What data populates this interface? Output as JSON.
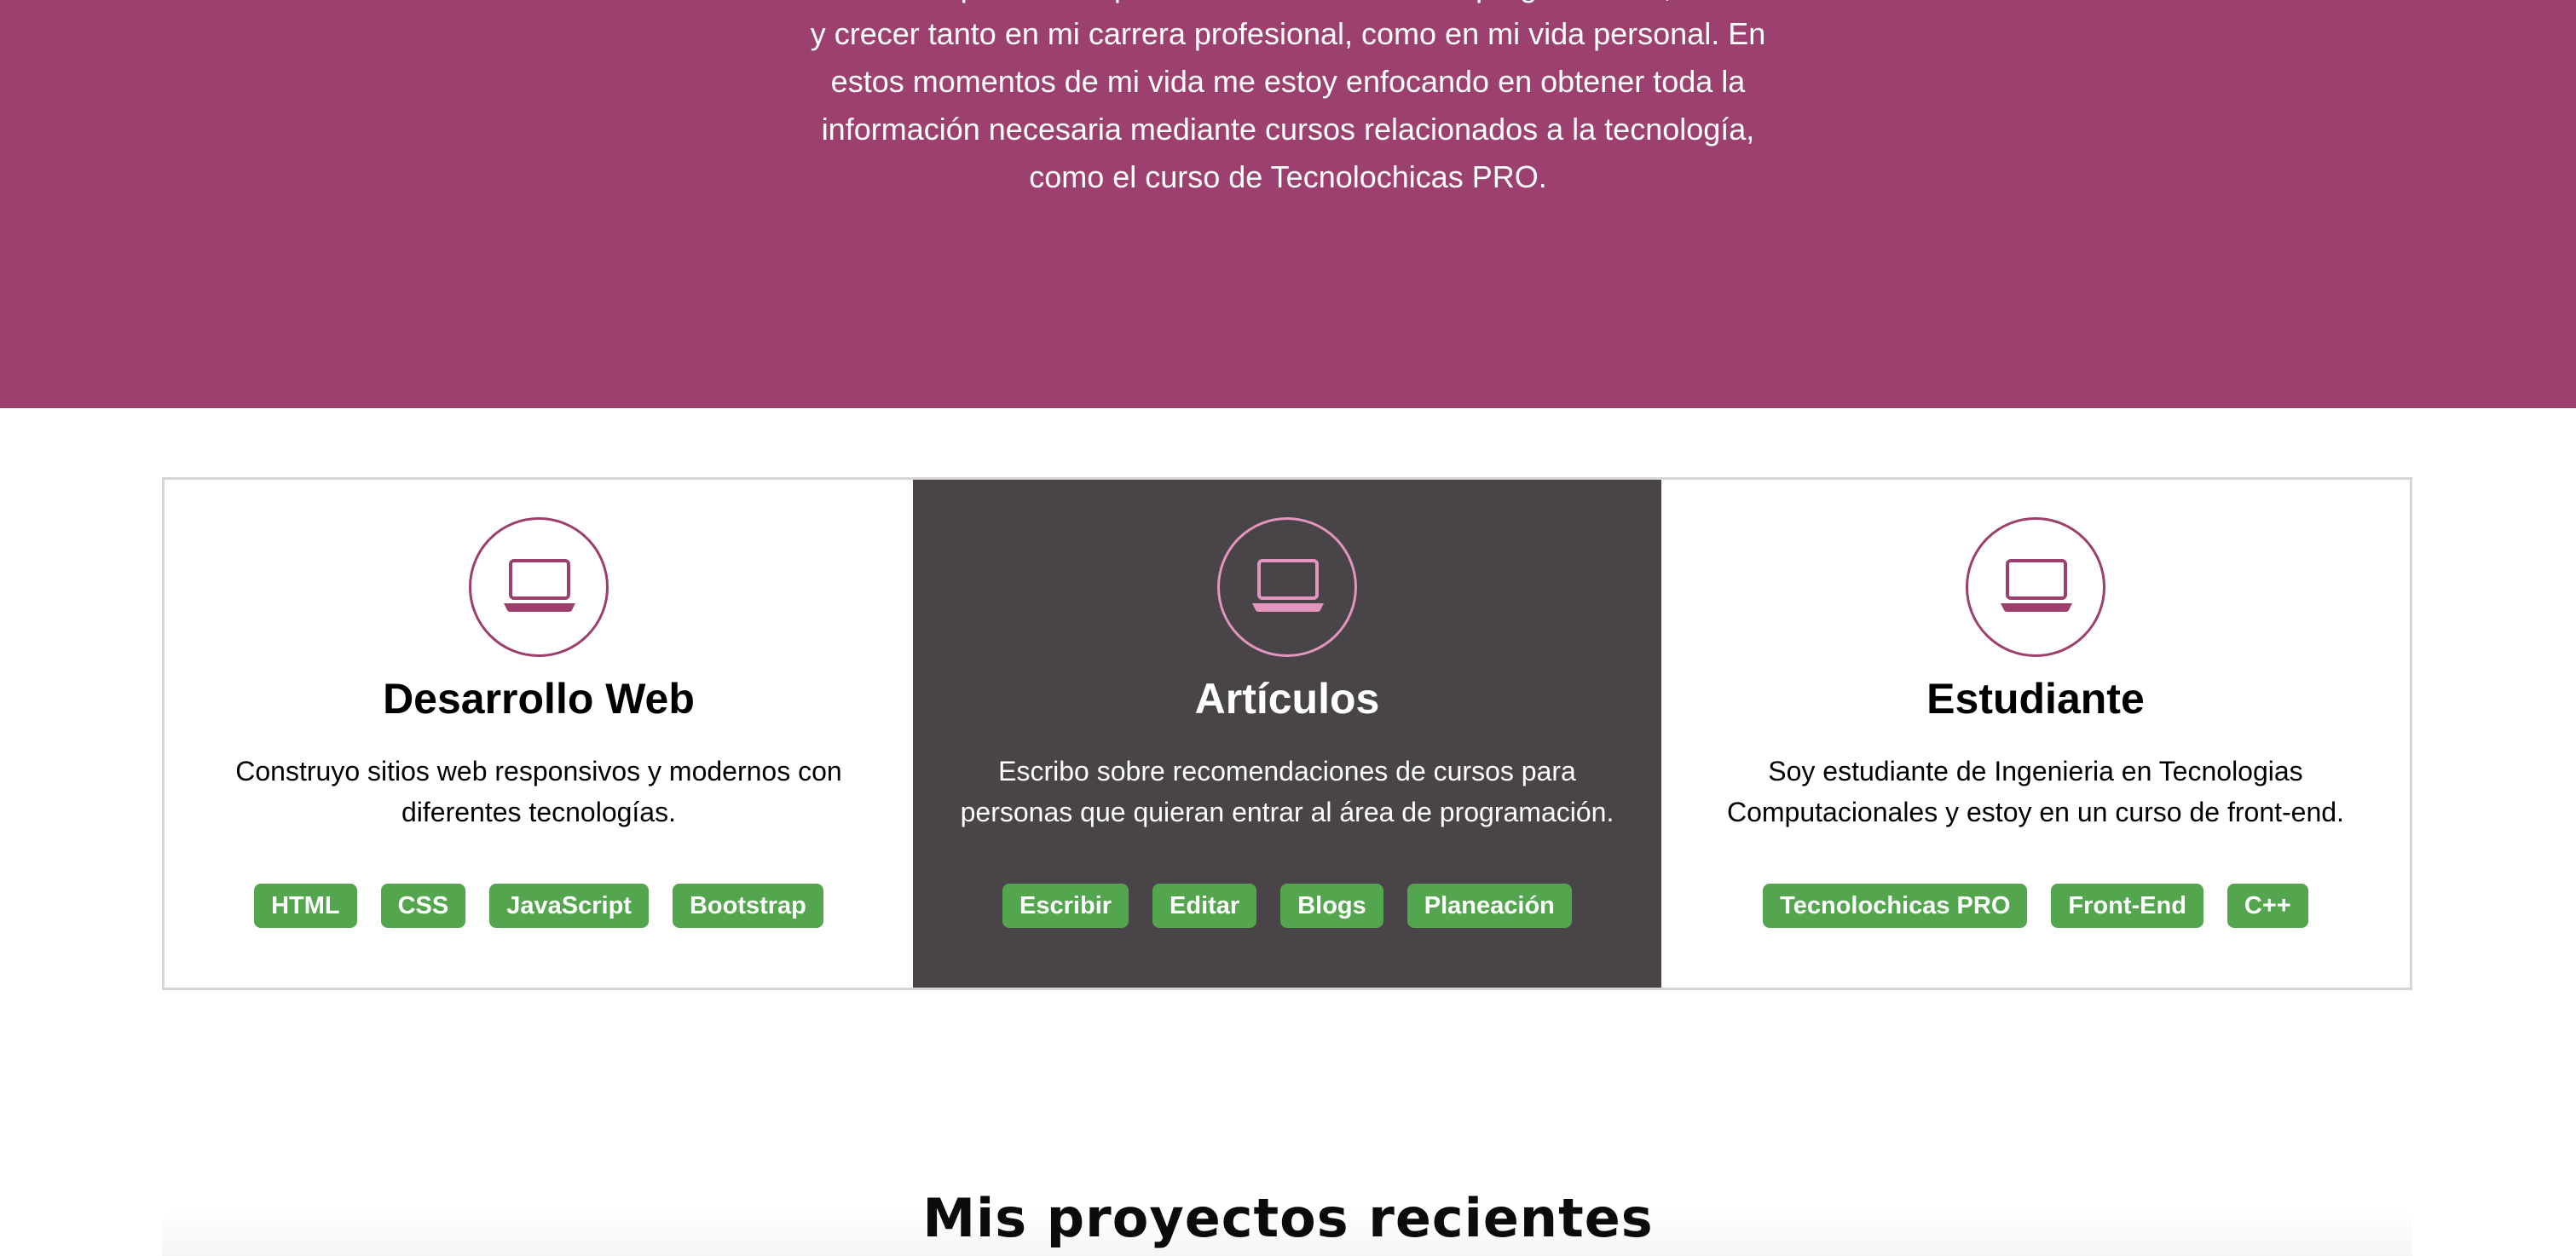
{
  "hero": {
    "lines": [
      "… aprender … para … en el mundo de la programación,",
      "y crecer tanto en mi carrera profesional, como en mi vida personal. En",
      "estos momentos de mi vida me estoy enfocando en obtener toda la",
      "información necesaria mediante cursos relacionados a la tecnología,",
      "como el curso de Tecnolochicas PRO."
    ]
  },
  "cards": [
    {
      "icon": "laptop-icon",
      "title": "Desarrollo Web",
      "desc": [
        "Construyo sitios web responsivos y modernos con",
        "diferentes tecnologías."
      ],
      "tags": [
        "HTML",
        "CSS",
        "JavaScript",
        "Bootstrap"
      ]
    },
    {
      "icon": "laptop-icon",
      "title": "Artículos",
      "desc": [
        "Escribo sobre recomendaciones de cursos para",
        "personas que quieran entrar al área de programación."
      ],
      "tags": [
        "Escribir",
        "Editar",
        "Blogs",
        "Planeación"
      ]
    },
    {
      "icon": "laptop-icon",
      "title": "Estudiante",
      "desc": [
        "Soy estudiante de Ingenieria en Tecnologias",
        "Computacionales y estoy en un curso de front-end."
      ],
      "tags": [
        "Tecnolochicas PRO",
        "Front-End",
        "C++"
      ]
    }
  ],
  "projects": {
    "title": "Mis proyectos recientes"
  },
  "colors": {
    "hero_bg": "#9c4070",
    "dark_card_bg": "#484447",
    "tag_bg": "#53a54e",
    "icon_accent": "#9c3f6c",
    "icon_accent_dark": "#e295bf"
  }
}
